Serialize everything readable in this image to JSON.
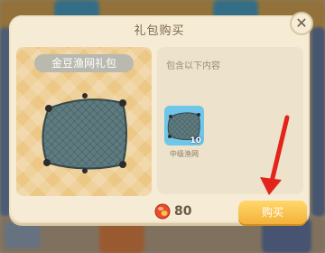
{
  "dialog": {
    "title": "礼包购买",
    "pack_name": "金豆渔网礼包",
    "contents_label": "包含以下内容",
    "items": [
      {
        "name": "中级渔网",
        "qty": "10",
        "icon": "fishing-net-icon"
      }
    ],
    "price": "80",
    "buy_label": "购买",
    "close_icon": "close-icon"
  },
  "colors": {
    "dialog_bg": "#f6ecd6",
    "buy_button": "#f5b13a",
    "item_slot": "#6fc6e8",
    "arrow": "#e3241b"
  }
}
